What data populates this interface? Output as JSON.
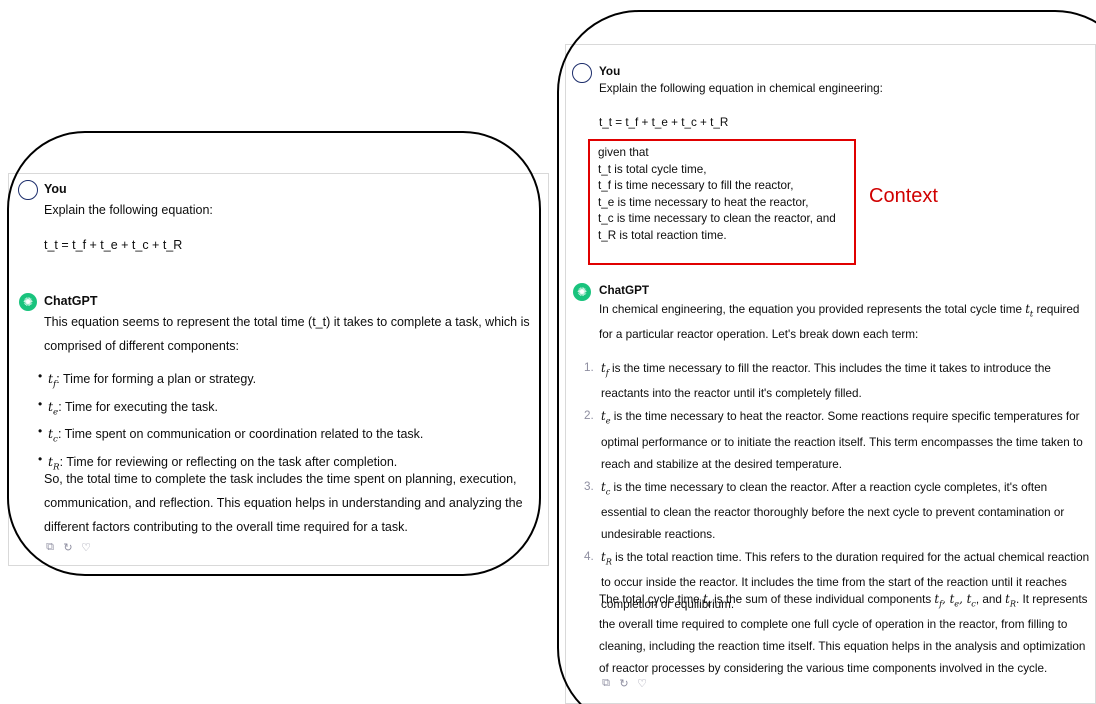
{
  "left": {
    "user_name": "You",
    "prompt": "Explain the following equation:",
    "equation": "t_t = t_f + t_e + t_c + t_R",
    "bot_name": "ChatGPT",
    "intro": "This equation seems to represent the total time (t_t) it takes to complete a task, which is comprised of different components:",
    "bullets": [
      {
        "sub": "f",
        "text": ": Time for forming a plan or strategy."
      },
      {
        "sub": "e",
        "text": ": Time for executing the task."
      },
      {
        "sub": "c",
        "text": ": Time spent on communication or coordination related to the task."
      },
      {
        "sub": "R",
        "text": ": Time for reviewing or reflecting on the task after completion."
      }
    ],
    "summary": "So, the total time to complete the task includes the time spent on planning, execution, communication, and reflection. This equation helps in understanding and analyzing the different factors contributing to the overall time required for a task."
  },
  "right": {
    "user_name": "You",
    "prompt": "Explain the following equation in chemical engineering:",
    "equation": "t_t = t_f + t_e + t_c + t_R",
    "context_lines": [
      "given that",
      "t_t is total cycle time,",
      "t_f is time necessary to fill the reactor,",
      "t_e is time necessary to heat the reactor,",
      "t_c is time necessary to clean the reactor, and",
      "t_R is total reaction time."
    ],
    "context_label": "Context",
    "bot_name": "ChatGPT",
    "intro_a": "In chemical engineering, the equation you provided represents the total cycle time ",
    "intro_b": " required for a particular reactor operation. Let's break down each term:",
    "items": [
      {
        "num": "1.",
        "sub": "f",
        "text": " is the time necessary to fill the reactor. This includes the time it takes to introduce the reactants into the reactor until it's completely filled."
      },
      {
        "num": "2.",
        "sub": "e",
        "text": " is the time necessary to heat the reactor. Some reactions require specific temperatures for optimal performance or to initiate the reaction itself. This term encompasses the time taken to reach and stabilize at the desired temperature."
      },
      {
        "num": "3.",
        "sub": "c",
        "text": " is the time necessary to clean the reactor. After a reaction cycle completes, it's often essential to clean the reactor thoroughly before the next cycle to prevent contamination or undesirable reactions."
      },
      {
        "num": "4.",
        "sub": "R",
        "text": " is the total reaction time. This refers to the duration required for the actual chemical reaction to occur inside the reactor. It includes the time from the start of the reaction until it reaches completion or equilibrium."
      }
    ],
    "summary_a": "The total cycle time ",
    "summary_b": " is the sum of these individual components ",
    "summary_c": ", and ",
    "summary_d": ". It represents the overall time required to complete one full cycle of operation in the reactor, from filling to cleaning, including the reaction time itself. This equation helps in the analysis and optimization of reactor processes by considering the various time components involved in the cycle."
  },
  "icons": {
    "copy": "clipboard-icon",
    "regenerate": "refresh-icon",
    "dislike": "thumbs-down-icon"
  },
  "colors": {
    "gpt_green": "#19c37d",
    "context_red": "#e00000",
    "avatar_border": "#1c2d6b"
  }
}
